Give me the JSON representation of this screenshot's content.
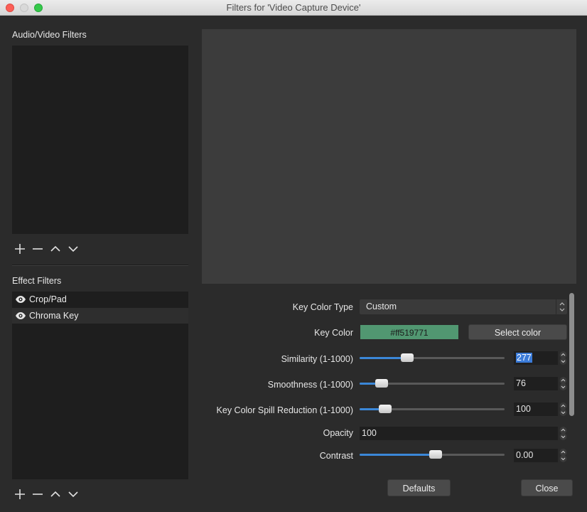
{
  "window": {
    "title": "Filters for 'Video Capture Device'"
  },
  "audio_video": {
    "label": "Audio/Video Filters",
    "items": []
  },
  "effect": {
    "label": "Effect Filters",
    "items": [
      {
        "label": "Crop/Pad",
        "visible": true,
        "selected": false
      },
      {
        "label": "Chroma Key",
        "visible": true,
        "selected": true
      }
    ]
  },
  "toolbar_icons": [
    "plus-icon",
    "minus-icon",
    "chevron-up-icon",
    "chevron-down-icon"
  ],
  "properties": {
    "key_color_type": {
      "label": "Key Color Type",
      "value": "Custom"
    },
    "key_color": {
      "label": "Key Color",
      "value": "#ff519771",
      "swatch": "#519771",
      "button": "Select color"
    },
    "similarity": {
      "label": "Similarity (1-1000)",
      "value": "277",
      "fraction": 0.277
    },
    "smoothness": {
      "label": "Smoothness (1-1000)",
      "value": "76",
      "fraction": 0.076
    },
    "spill": {
      "label": "Key Color Spill Reduction (1-1000)",
      "value": "100",
      "fraction": 0.1
    },
    "opacity": {
      "label": "Opacity",
      "value": "100"
    },
    "contrast": {
      "label": "Contrast",
      "value": "0.00",
      "fraction": 0.5
    }
  },
  "buttons": {
    "defaults": "Defaults",
    "close": "Close"
  },
  "colors": {
    "accent": "#3b87d8",
    "background": "#2b2b2b",
    "list_bg": "#1e1e1e"
  }
}
